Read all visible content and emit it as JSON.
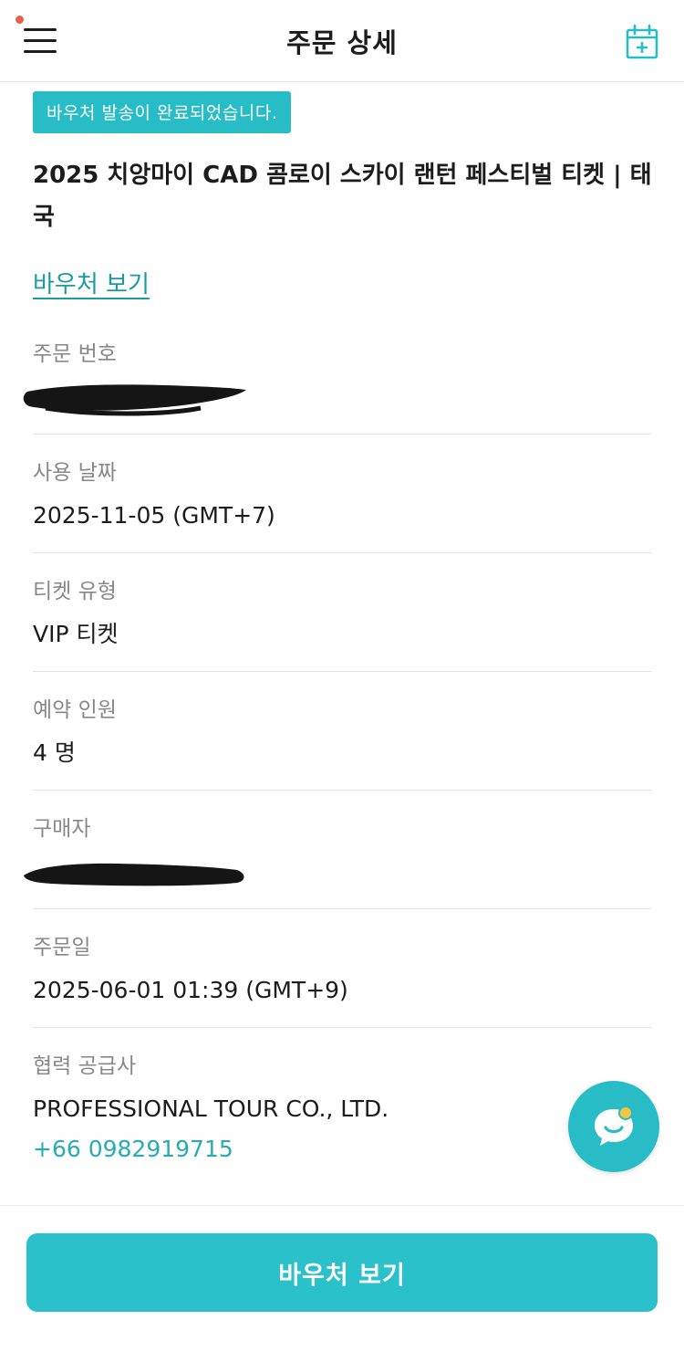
{
  "header": {
    "title": "주문 상세",
    "menu_icon": "hamburger-menu-icon",
    "calendar_icon": "calendar-add-icon",
    "notification_dot_color": "#e8604c"
  },
  "status_badge": "바우처 발송이 완료되었습니다.",
  "product_title": "2025 치앙마이 CAD 콤로이 스카이 랜턴 페스티벌 티켓 | 태국",
  "voucher_link": "바우처 보기",
  "fields": {
    "order_number": {
      "label": "주문 번호",
      "value": ""
    },
    "use_date": {
      "label": "사용 날짜",
      "value": "2025-11-05 (GMT+7)"
    },
    "ticket_type": {
      "label": "티켓 유형",
      "value": "VIP 티켓"
    },
    "guests": {
      "label": "예약 인원",
      "value": "4 명"
    },
    "buyer": {
      "label": "구매자",
      "value": ""
    },
    "order_date": {
      "label": "주문일",
      "value": "2025-06-01 01:39 (GMT+9)"
    },
    "supplier": {
      "label": "협력 공급사",
      "value": "PROFESSIONAL TOUR CO., LTD.",
      "phone": "+66 0982919715"
    }
  },
  "chat_icon": "chat-bubble-icon",
  "bottom_button": "바우처 보기",
  "colors": {
    "accent": "#27bcc6",
    "link": "#1a9aa6",
    "phone": "#27acb5"
  }
}
